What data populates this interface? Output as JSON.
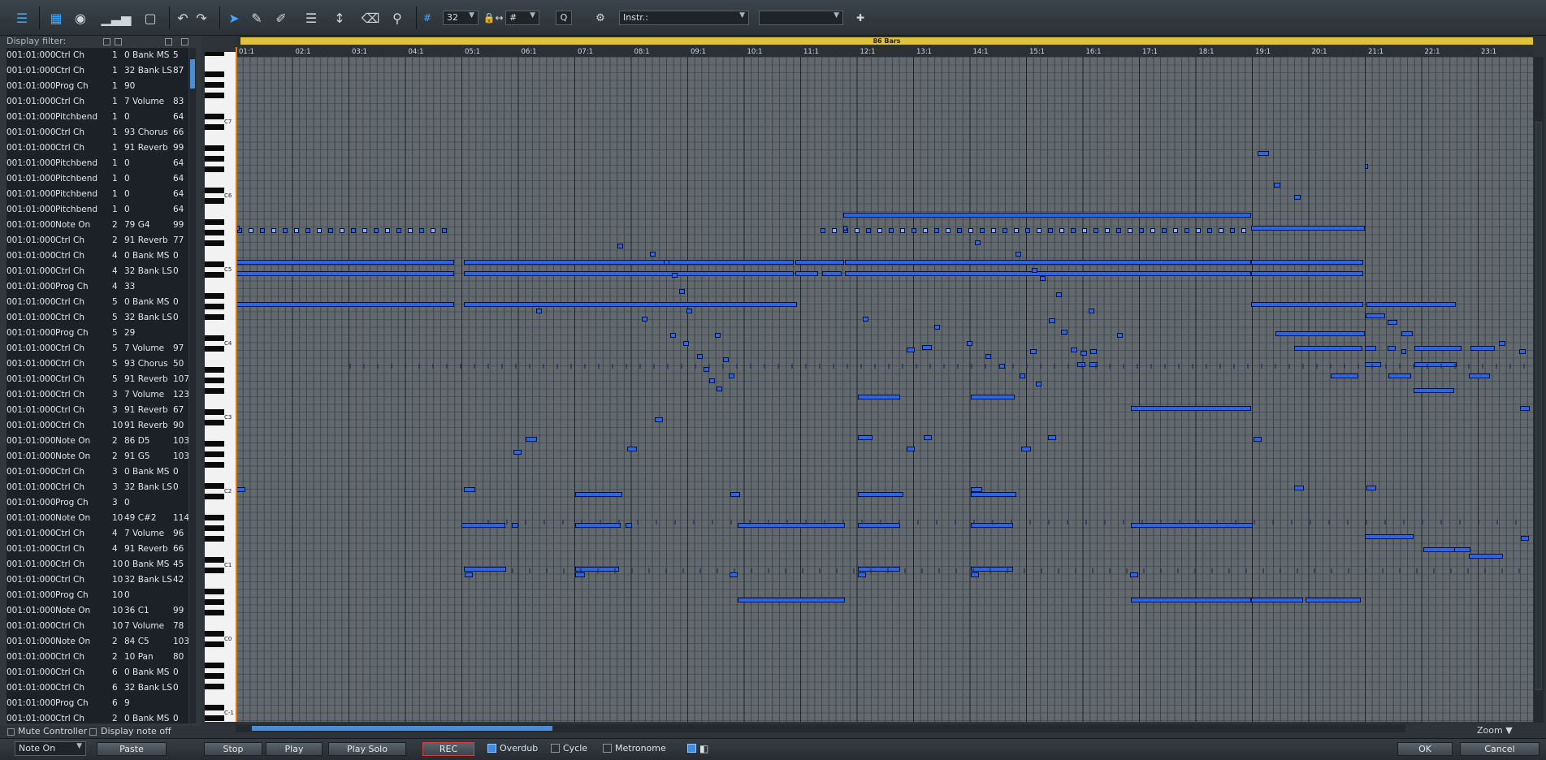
{
  "toolbar": {
    "quantize_value": "32",
    "length_value": "#",
    "q_label": "Q",
    "instrument": "Instr.:",
    "channel": ""
  },
  "panel": {
    "display_filter": "Display filter:",
    "mute_controller": "Mute Controller",
    "display_note_off": "Display note off",
    "event_type": "Note On",
    "paste": "Paste"
  },
  "events": [
    [
      "001:01:000",
      "Ctrl Ch",
      "1",
      "0 Bank MS",
      "5"
    ],
    [
      "001:01:000",
      "Ctrl Ch",
      "1",
      "32 Bank LS",
      "87"
    ],
    [
      "001:01:000",
      "Prog Ch",
      "1",
      "90",
      ""
    ],
    [
      "001:01:000",
      "Ctrl Ch",
      "1",
      "7 Volume",
      "83"
    ],
    [
      "001:01:000",
      "Pitchbend",
      "1",
      "0",
      "64"
    ],
    [
      "001:01:000",
      "Ctrl Ch",
      "1",
      "93 Chorus",
      "66"
    ],
    [
      "001:01:000",
      "Ctrl Ch",
      "1",
      "91 Reverb",
      "99"
    ],
    [
      "001:01:000",
      "Pitchbend",
      "1",
      "0",
      "64"
    ],
    [
      "001:01:000",
      "Pitchbend",
      "1",
      "0",
      "64"
    ],
    [
      "001:01:000",
      "Pitchbend",
      "1",
      "0",
      "64"
    ],
    [
      "001:01:000",
      "Pitchbend",
      "1",
      "0",
      "64"
    ],
    [
      "001:01:000",
      "Note On",
      "2",
      "79   G4",
      "99"
    ],
    [
      "001:01:000",
      "Ctrl Ch",
      "2",
      "91 Reverb",
      "77"
    ],
    [
      "001:01:000",
      "Ctrl Ch",
      "4",
      "0 Bank MS",
      "0"
    ],
    [
      "001:01:000",
      "Ctrl Ch",
      "4",
      "32 Bank LS",
      "0"
    ],
    [
      "001:01:000",
      "Prog Ch",
      "4",
      "33",
      ""
    ],
    [
      "001:01:000",
      "Ctrl Ch",
      "5",
      "0 Bank MS",
      "0"
    ],
    [
      "001:01:000",
      "Ctrl Ch",
      "5",
      "32 Bank LS",
      "0"
    ],
    [
      "001:01:000",
      "Prog Ch",
      "5",
      "29",
      ""
    ],
    [
      "001:01:000",
      "Ctrl Ch",
      "5",
      "7 Volume",
      "97"
    ],
    [
      "001:01:000",
      "Ctrl Ch",
      "5",
      "93 Chorus",
      "50"
    ],
    [
      "001:01:000",
      "Ctrl Ch",
      "5",
      "91 Reverb",
      "107"
    ],
    [
      "001:01:000",
      "Ctrl Ch",
      "3",
      "7 Volume",
      "123"
    ],
    [
      "001:01:000",
      "Ctrl Ch",
      "3",
      "91 Reverb",
      "67"
    ],
    [
      "001:01:000",
      "Ctrl Ch",
      "10",
      "91 Reverb",
      "90"
    ],
    [
      "001:01:000",
      "Note On",
      "2",
      "86   D5",
      "103"
    ],
    [
      "001:01:000",
      "Note On",
      "2",
      "91   G5",
      "103"
    ],
    [
      "001:01:000",
      "Ctrl Ch",
      "3",
      "0 Bank MS",
      "0"
    ],
    [
      "001:01:000",
      "Ctrl Ch",
      "3",
      "32 Bank LS",
      "0"
    ],
    [
      "001:01:000",
      "Prog Ch",
      "3",
      "0",
      ""
    ],
    [
      "001:01:000",
      "Note On",
      "10",
      "49   C#2",
      "114"
    ],
    [
      "001:01:000",
      "Ctrl Ch",
      "4",
      "7 Volume",
      "96"
    ],
    [
      "001:01:000",
      "Ctrl Ch",
      "4",
      "91 Reverb",
      "66"
    ],
    [
      "001:01:000",
      "Ctrl Ch",
      "10",
      "0 Bank MS",
      "45"
    ],
    [
      "001:01:000",
      "Ctrl Ch",
      "10",
      "32 Bank LS",
      "42"
    ],
    [
      "001:01:000",
      "Prog Ch",
      "10",
      "0",
      ""
    ],
    [
      "001:01:000",
      "Note On",
      "10",
      "36   C1",
      "99"
    ],
    [
      "001:01:000",
      "Ctrl Ch",
      "10",
      "7 Volume",
      "78"
    ],
    [
      "001:01:000",
      "Note On",
      "2",
      "84   C5",
      "103"
    ],
    [
      "001:01:000",
      "Ctrl Ch",
      "2",
      "10 Pan",
      "80"
    ],
    [
      "001:01:000",
      "Ctrl Ch",
      "6",
      "0 Bank MS",
      "0"
    ],
    [
      "001:01:000",
      "Ctrl Ch",
      "6",
      "32 Bank LS",
      "0"
    ],
    [
      "001:01:000",
      "Prog Ch",
      "6",
      "9",
      ""
    ],
    [
      "001:01:000",
      "Ctrl Ch",
      "2",
      "0 Bank MS",
      "0"
    ]
  ],
  "ruler": {
    "loop_label": "86 Bars",
    "bars": [
      "01:1",
      "02:1",
      "03:1",
      "04:1",
      "05:1",
      "06:1",
      "07:1",
      "08:1",
      "09:1",
      "10:1",
      "11:1",
      "12:1",
      "13:1",
      "14:1",
      "15:1",
      "16:1",
      "17:1",
      "18:1",
      "19:1",
      "20:1",
      "21:1",
      "22:1",
      "23:1"
    ]
  },
  "octaves": [
    "C7",
    "C6",
    "C5",
    "C4",
    "C3",
    "C2",
    "C1",
    "C0",
    "C-1"
  ],
  "notes": [
    [
      1548,
      186,
      14
    ],
    [
      1568,
      225,
      8
    ],
    [
      1593,
      240,
      8
    ],
    [
      1680,
      202,
      4
    ],
    [
      1038,
      262,
      502
    ],
    [
      1038,
      278,
      5
    ],
    [
      291,
      278,
      4
    ],
    [
      1540,
      278,
      140
    ],
    [
      291,
      320,
      268
    ],
    [
      571,
      320,
      406
    ],
    [
      979,
      320,
      60
    ],
    [
      1040,
      320,
      500
    ],
    [
      1540,
      320,
      138
    ],
    [
      291,
      334,
      268
    ],
    [
      571,
      334,
      406
    ],
    [
      979,
      334,
      28
    ],
    [
      1012,
      334,
      24
    ],
    [
      1040,
      334,
      500
    ],
    [
      1540,
      334,
      138
    ],
    [
      291,
      372,
      268
    ],
    [
      571,
      372,
      410
    ],
    [
      1540,
      372,
      138
    ],
    [
      1682,
      372,
      110
    ],
    [
      1681,
      386,
      24
    ],
    [
      1708,
      394,
      12
    ],
    [
      1291,
      392,
      8
    ],
    [
      1306,
      406,
      8
    ],
    [
      1725,
      408,
      14
    ],
    [
      1570,
      408,
      110
    ],
    [
      1116,
      428,
      10
    ],
    [
      1135,
      425,
      12
    ],
    [
      1593,
      426,
      84
    ],
    [
      1268,
      430,
      8
    ],
    [
      1318,
      428,
      8
    ],
    [
      1330,
      432,
      8
    ],
    [
      1342,
      430,
      8
    ],
    [
      1680,
      426,
      14
    ],
    [
      1708,
      426,
      10
    ],
    [
      1725,
      430,
      6
    ],
    [
      1741,
      426,
      58
    ],
    [
      1810,
      426,
      30
    ],
    [
      1845,
      420,
      8
    ],
    [
      1870,
      430,
      8
    ],
    [
      1326,
      446,
      10
    ],
    [
      1341,
      446,
      10
    ],
    [
      1680,
      446,
      20
    ],
    [
      1741,
      446,
      52
    ],
    [
      1638,
      460,
      34
    ],
    [
      1709,
      460,
      28
    ],
    [
      1808,
      460,
      26
    ],
    [
      1740,
      478,
      50
    ],
    [
      1056,
      486,
      52
    ],
    [
      1195,
      486,
      54
    ],
    [
      1392,
      500,
      148
    ],
    [
      1871,
      500,
      12
    ],
    [
      806,
      514,
      10
    ],
    [
      1056,
      536,
      18
    ],
    [
      1137,
      536,
      10
    ],
    [
      1290,
      536,
      10
    ],
    [
      1543,
      538,
      10
    ],
    [
      647,
      538,
      14
    ],
    [
      772,
      550,
      12
    ],
    [
      1116,
      550,
      10
    ],
    [
      1257,
      550,
      12
    ],
    [
      632,
      554,
      10
    ],
    [
      290,
      600,
      12
    ],
    [
      571,
      600,
      14
    ],
    [
      708,
      606,
      58
    ],
    [
      899,
      606,
      12
    ],
    [
      1056,
      606,
      56
    ],
    [
      1195,
      600,
      14
    ],
    [
      1195,
      606,
      56
    ],
    [
      1593,
      598,
      12
    ],
    [
      1682,
      598,
      12
    ],
    [
      568,
      644,
      54
    ],
    [
      630,
      644,
      8
    ],
    [
      708,
      644,
      56
    ],
    [
      770,
      644,
      8
    ],
    [
      908,
      644,
      132
    ],
    [
      1056,
      644,
      52
    ],
    [
      1195,
      644,
      52
    ],
    [
      1392,
      644,
      150
    ],
    [
      1680,
      658,
      60
    ],
    [
      1752,
      674,
      42
    ],
    [
      1790,
      674,
      20
    ],
    [
      1808,
      682,
      42
    ],
    [
      1872,
      660,
      10
    ],
    [
      571,
      698,
      52
    ],
    [
      708,
      698,
      54
    ],
    [
      1056,
      698,
      52
    ],
    [
      1195,
      698,
      52
    ],
    [
      572,
      705,
      10
    ],
    [
      708,
      705,
      12
    ],
    [
      898,
      705,
      10
    ],
    [
      1056,
      705,
      10
    ],
    [
      1195,
      705,
      10
    ],
    [
      1391,
      705,
      10
    ],
    [
      908,
      736,
      132
    ],
    [
      1392,
      736,
      148
    ],
    [
      1540,
      736,
      64
    ],
    [
      1607,
      736,
      68
    ]
  ],
  "scatter": [
    [
      760,
      300
    ],
    [
      800,
      310
    ],
    [
      817,
      320
    ],
    [
      827,
      336
    ],
    [
      836,
      356
    ],
    [
      845,
      380
    ],
    [
      880,
      410
    ],
    [
      890,
      440
    ],
    [
      897,
      460
    ],
    [
      1200,
      296
    ],
    [
      1250,
      310
    ],
    [
      1270,
      330
    ],
    [
      1280,
      340
    ],
    [
      1300,
      360
    ],
    [
      1340,
      380
    ],
    [
      1375,
      410
    ],
    [
      660,
      380
    ],
    [
      790,
      390
    ],
    [
      825,
      410
    ],
    [
      841,
      420
    ],
    [
      858,
      436
    ],
    [
      866,
      452
    ],
    [
      873,
      466
    ],
    [
      882,
      476
    ],
    [
      1062,
      390
    ],
    [
      1150,
      400
    ],
    [
      1190,
      420
    ],
    [
      1213,
      436
    ],
    [
      1230,
      448
    ],
    [
      1255,
      460
    ],
    [
      1275,
      470
    ]
  ],
  "bottom": {
    "stop": "Stop",
    "play": "Play",
    "play_solo": "Play Solo",
    "rec": "REC",
    "overdub": "Overdub",
    "cycle": "Cycle",
    "metronome": "Metronome",
    "ok": "OK",
    "cancel": "Cancel",
    "zoom": "Zoom"
  }
}
